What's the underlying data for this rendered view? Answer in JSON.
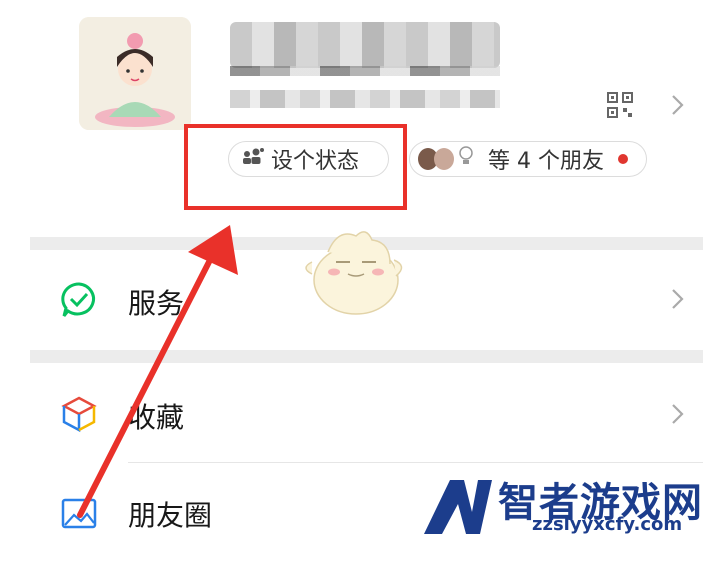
{
  "profile": {
    "avatar_icon": "cartoon-girl-avatar",
    "qr_icon": "qr-code-icon",
    "status_button_label": "设个状态",
    "friends_label": "等 4 个朋友"
  },
  "menu": [
    {
      "label": "服务",
      "icon": "service-check-icon"
    },
    {
      "label": "收藏",
      "icon": "favorites-cube-icon"
    },
    {
      "label": "朋友圈",
      "icon": "moments-image-icon"
    }
  ],
  "watermark": {
    "title": "智者游戏网",
    "url": "zzslyyxcfy.com"
  },
  "colors": {
    "highlight_red": "#e9312a",
    "wechat_green": "#07c160",
    "watermark_blue": "#1c3d8c"
  }
}
